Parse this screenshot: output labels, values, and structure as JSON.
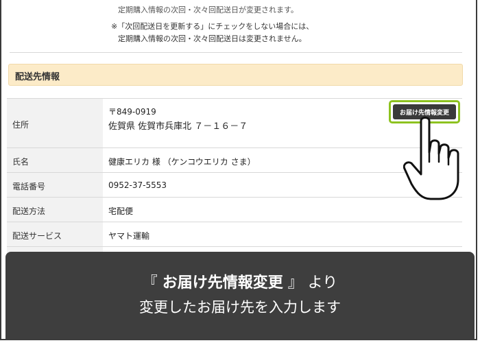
{
  "notes": {
    "line0": "定期購入情報の次回・次々回配送日が変更されます。",
    "line1": "※「次回配送日を更新する」にチェックをしない場合には、",
    "line2": "定期購入情報の次回・次々回配送日は変更されません。"
  },
  "section": {
    "title": "配送先情報"
  },
  "rows": [
    {
      "label": "住所",
      "value_line1": "〒849-0919",
      "value_line2": "佐賀県 佐賀市兵庫北 ７－１６－７"
    },
    {
      "label": "氏名",
      "value": "健康エリカ 様 （ケンコウエリカ さま）"
    },
    {
      "label": "電話番号",
      "value": "0952-37-5553"
    },
    {
      "label": "配送方法",
      "value": "宅配便"
    },
    {
      "label": "配送サービス",
      "value": "ヤマト運輸"
    }
  ],
  "edit_button": {
    "label": "お届け先情報変更"
  },
  "caption": {
    "open_bracket": "『",
    "highlight": "お届け先情報変更",
    "close_bracket": "』",
    "suffix": "より",
    "line2": "変更したお届け先を入力します"
  },
  "icons": {
    "hand": "pointing-hand-icon"
  },
  "colors": {
    "accent": "#8dc21f",
    "section_bg": "#fcebc8",
    "panel_bg": "#3e3e3e",
    "button_bg": "#3a3a3a"
  }
}
